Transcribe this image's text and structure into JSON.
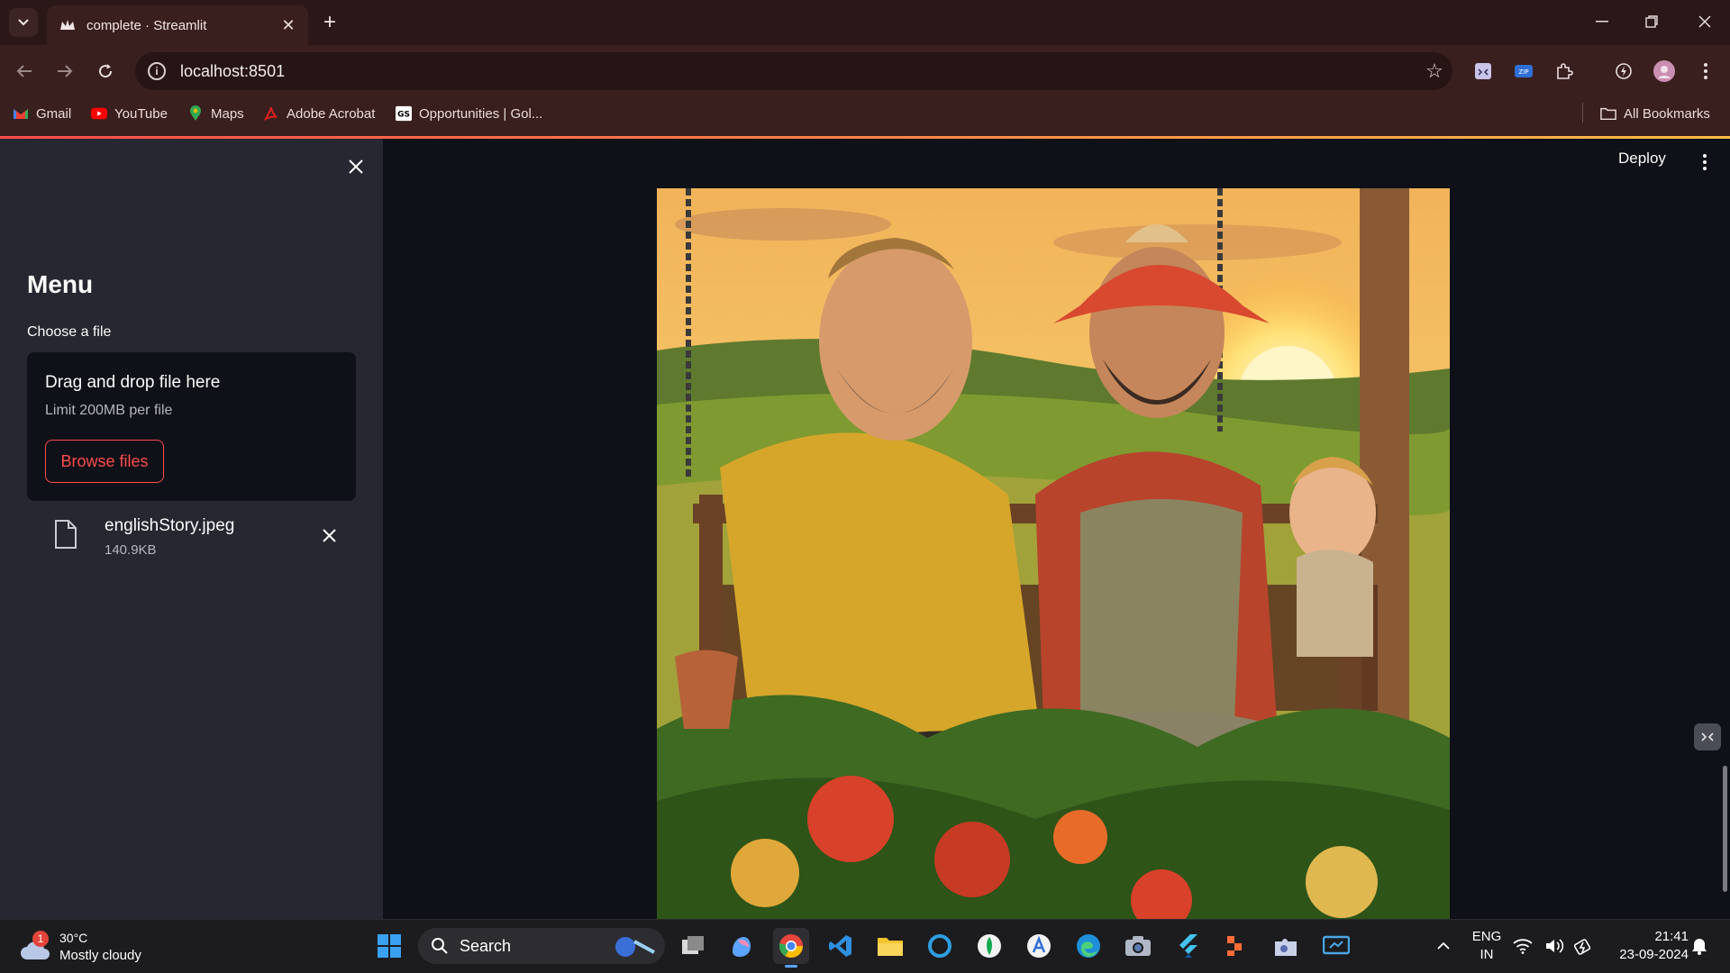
{
  "browser": {
    "tab_title": "complete · Streamlit",
    "url": "localhost:8501",
    "bookmarks": [
      "Gmail",
      "YouTube",
      "Maps",
      "Adobe Acrobat",
      "Opportunities | Gol...",
      "All Bookmarks"
    ],
    "extensions": [
      "zip-extension-icon",
      "extensions-puzzle-icon",
      "performance-icon",
      "profile-avatar"
    ]
  },
  "app": {
    "header": {
      "deploy_label": "Deploy"
    },
    "sidebar": {
      "title": "Menu",
      "uploader_label": "Choose a file",
      "dropzone_title": "Drag and drop file here",
      "dropzone_limit": "Limit 200MB per file",
      "browse_label": "Browse files",
      "file_name": "englishStory.jpeg",
      "file_size": "140.9KB"
    }
  },
  "taskbar": {
    "weather_temp": "30°C",
    "weather_desc": "Mostly cloudy",
    "weather_badge": "1",
    "search_label": "Search",
    "lang_top": "ENG",
    "lang_bottom": "IN",
    "time": "21:41",
    "date": "23-09-2024"
  },
  "colors": {
    "accent": "#ff4b4b",
    "sidebar_bg": "#262730",
    "main_bg": "#0e1117",
    "chrome_bg": "#3a1f1f"
  }
}
